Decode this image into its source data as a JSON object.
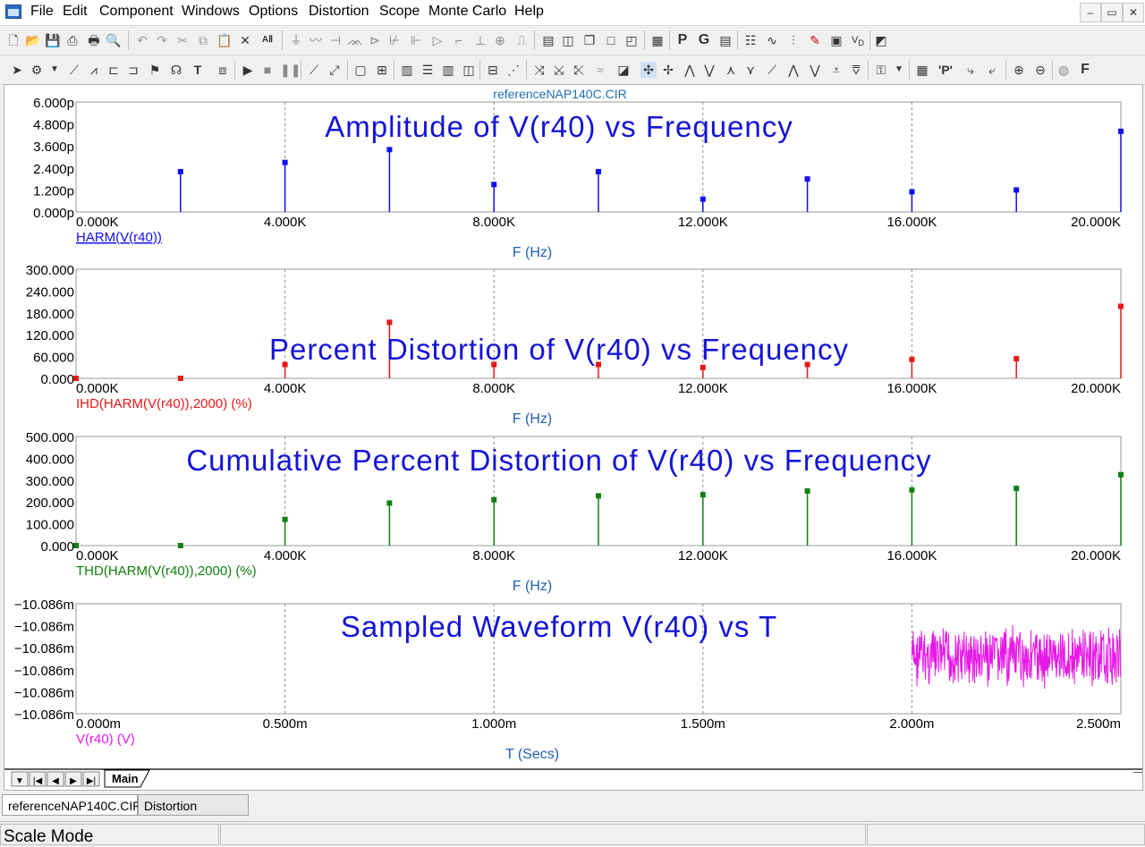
{
  "menu": [
    "File",
    "Edit",
    "Component",
    "Windows",
    "Options",
    "Distortion",
    "Scope",
    "Monte Carlo",
    "Help"
  ],
  "window_controls": [
    "–",
    "▭",
    "✕"
  ],
  "plot": {
    "title_file": "referenceNAP140C.CIR",
    "sheet_tab": "Main",
    "panels": [
      {
        "heading": "Amplitude of V(r40) vs Frequency",
        "legend": "HARM(V(r40))",
        "xlabel": "F (Hz)",
        "color": "#1010ee",
        "ylim": [
          0,
          6.0
        ],
        "yticks": [
          "0.000p",
          "1.200p",
          "2.400p",
          "3.600p",
          "4.800p",
          "6.000p"
        ],
        "xlim": [
          0,
          20000
        ],
        "xticks": [
          "0.000K",
          "4.000K",
          "8.000K",
          "12.000K",
          "16.000K",
          "20.000K"
        ]
      },
      {
        "heading": "Percent Distortion of V(r40) vs Frequency",
        "legend": "IHD(HARM(V(r40)),2000) (%)",
        "xlabel": "F (Hz)",
        "color": "#e81818",
        "ylim": [
          0,
          300
        ],
        "yticks": [
          "0.000",
          "60.000",
          "120.000",
          "180.000",
          "240.000",
          "300.000"
        ],
        "xlim": [
          0,
          20000
        ],
        "xticks": [
          "0.000K",
          "4.000K",
          "8.000K",
          "12.000K",
          "16.000K",
          "20.000K"
        ]
      },
      {
        "heading": "Cumulative Percent Distortion of V(r40) vs Frequency",
        "legend": "THD(HARM(V(r40)),2000) (%)",
        "xlabel": "F (Hz)",
        "color": "#108010",
        "ylim": [
          0,
          500
        ],
        "yticks": [
          "0.000",
          "100.000",
          "200.000",
          "300.000",
          "400.000",
          "500.000"
        ],
        "xlim": [
          0,
          20000
        ],
        "xticks": [
          "0.000K",
          "4.000K",
          "8.000K",
          "12.000K",
          "16.000K",
          "20.000K"
        ]
      },
      {
        "heading": "Sampled Waveform  V(r40) vs T",
        "legend": "V(r40) (V)",
        "xlabel": "T (Secs)",
        "color": "#e619e6",
        "yticks": [
          "−10.086m",
          "−10.086m",
          "−10.086m",
          "−10.086m",
          "−10.086m",
          "−10.086m"
        ],
        "xlim": [
          0,
          2.5
        ],
        "xticks": [
          "0.000m",
          "0.500m",
          "1.000m",
          "1.500m",
          "2.000m",
          "2.500m"
        ]
      }
    ]
  },
  "chart_data": [
    {
      "type": "bar",
      "x": [
        2000,
        4000,
        6000,
        8000,
        10000,
        12000,
        14000,
        16000,
        18000,
        20000
      ],
      "values": [
        2.2,
        2.7,
        3.4,
        1.5,
        2.2,
        0.7,
        1.8,
        1.1,
        1.2,
        4.4
      ],
      "ylim": [
        0,
        6.0
      ],
      "xlim": [
        0,
        20000
      ]
    },
    {
      "type": "bar",
      "x": [
        0,
        2000,
        4000,
        6000,
        8000,
        10000,
        12000,
        14000,
        16000,
        18000,
        20000
      ],
      "values": [
        0,
        0,
        38,
        154,
        38,
        38,
        30,
        38,
        52,
        54,
        198
      ],
      "ylim": [
        0,
        300
      ],
      "xlim": [
        0,
        20000
      ]
    },
    {
      "type": "bar",
      "x": [
        0,
        2000,
        4000,
        6000,
        8000,
        10000,
        12000,
        14000,
        16000,
        18000,
        20000
      ],
      "values": [
        0,
        0,
        120,
        195,
        210,
        228,
        233,
        250,
        255,
        262,
        325
      ],
      "ylim": [
        0,
        500
      ],
      "xlim": [
        0,
        20000
      ]
    },
    {
      "type": "line",
      "x_range": [
        2.0,
        2.5
      ],
      "xlim": [
        0,
        2.5
      ]
    }
  ],
  "tabs": [
    "referenceNAP140C.CIR",
    "Distortion Analysis"
  ],
  "status": {
    "mode": "Scale Mode"
  }
}
